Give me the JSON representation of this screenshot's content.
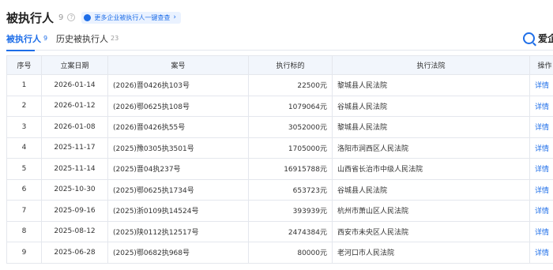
{
  "header": {
    "title": "被执行人",
    "count": "9",
    "help_glyph": "?",
    "promo_text": "更多企业被执行人一键查查",
    "promo_arrow": "›"
  },
  "tabs": [
    {
      "label": "被执行人",
      "count": "9",
      "active": true
    },
    {
      "label": "历史被执行人",
      "count": "23",
      "active": false
    }
  ],
  "brand": {
    "text": "爱企",
    "icon": "search-logo-icon"
  },
  "table": {
    "columns": [
      "序号",
      "立案日期",
      "案号",
      "执行标的",
      "执行法院",
      "操作"
    ],
    "rows": [
      {
        "no": "1",
        "date": "2026-01-14",
        "case": "(2026)晋0426执103号",
        "amount": "22500元",
        "court": "黎城县人民法院",
        "action": "详情"
      },
      {
        "no": "2",
        "date": "2026-01-12",
        "case": "(2026)鄂0625执108号",
        "amount": "1079064元",
        "court": "谷城县人民法院",
        "action": "详情"
      },
      {
        "no": "3",
        "date": "2026-01-08",
        "case": "(2026)晋0426执55号",
        "amount": "3052000元",
        "court": "黎城县人民法院",
        "action": "详情"
      },
      {
        "no": "4",
        "date": "2025-11-17",
        "case": "(2025)豫0305执3501号",
        "amount": "1705000元",
        "court": "洛阳市涧西区人民法院",
        "action": "详情"
      },
      {
        "no": "5",
        "date": "2025-11-14",
        "case": "(2025)晋04执237号",
        "amount": "16915788元",
        "court": "山西省长治市中级人民法院",
        "action": "详情"
      },
      {
        "no": "6",
        "date": "2025-10-30",
        "case": "(2025)鄂0625执1734号",
        "amount": "653723元",
        "court": "谷城县人民法院",
        "action": "详情"
      },
      {
        "no": "7",
        "date": "2025-09-16",
        "case": "(2025)浙0109执14524号",
        "amount": "393939元",
        "court": "杭州市萧山区人民法院",
        "action": "详情"
      },
      {
        "no": "8",
        "date": "2025-08-12",
        "case": "(2025)陕0112执12517号",
        "amount": "2474384元",
        "court": "西安市未央区人民法院",
        "action": "详情"
      },
      {
        "no": "9",
        "date": "2025-06-28",
        "case": "(2025)鄂0682执968号",
        "amount": "80000元",
        "court": "老河口市人民法院",
        "action": "详情"
      }
    ]
  },
  "colors": {
    "accent": "#1e6ee8",
    "header_bg": "#f2f6fc",
    "border": "#e4e7ed"
  }
}
